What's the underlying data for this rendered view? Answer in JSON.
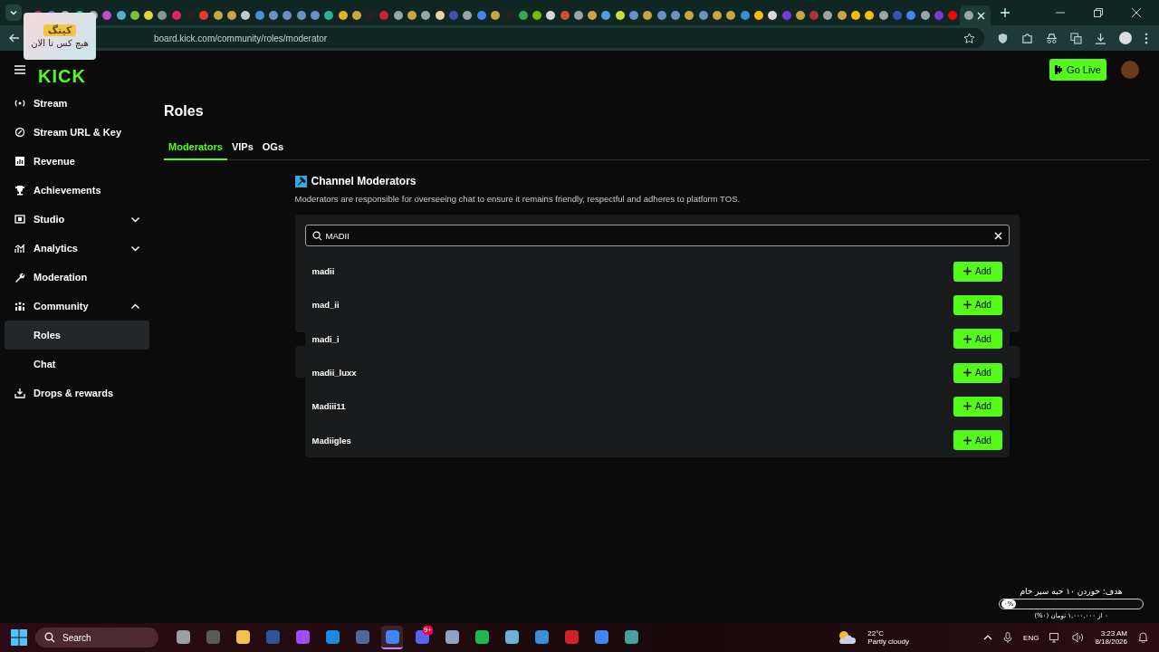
{
  "browser": {
    "tabs": [
      {
        "color": "#e0245e",
        "selected": false
      },
      {
        "color": "#5b6cff",
        "selected": false
      },
      {
        "color": "#8fbf9f",
        "selected": false
      },
      {
        "color": "#2ecc71",
        "selected": false
      },
      {
        "color": "#9aa5a8",
        "selected": false
      },
      {
        "color": "#c04bd0",
        "selected": false
      },
      {
        "color": "#4fb0c6",
        "selected": false
      },
      {
        "color": "#7fbf3f",
        "selected": false
      },
      {
        "color": "#e6d23a",
        "selected": false
      },
      {
        "color": "#8a9490",
        "selected": false
      },
      {
        "color": "#e0245e",
        "selected": false
      },
      {
        "color": "#222222",
        "selected": false
      },
      {
        "color": "#e53935",
        "selected": false
      },
      {
        "color": "#c9a640",
        "selected": false
      },
      {
        "color": "#c9a640",
        "selected": false
      },
      {
        "color": "#bfc7c9",
        "selected": false
      },
      {
        "color": "#4a90d9",
        "selected": false
      },
      {
        "color": "#6d8fc7",
        "selected": false
      },
      {
        "color": "#6d8fc7",
        "selected": false
      },
      {
        "color": "#6d8fc7",
        "selected": false
      },
      {
        "color": "#6d8fc7",
        "selected": false
      },
      {
        "color": "#2bb39a",
        "selected": false
      },
      {
        "color": "#e6b422",
        "selected": false
      },
      {
        "color": "#c9a640",
        "selected": false
      },
      {
        "color": "#222222",
        "selected": false
      },
      {
        "color": "#c8203a",
        "selected": false
      },
      {
        "color": "#9aa5a8",
        "selected": false
      },
      {
        "color": "#c9a640",
        "selected": false
      },
      {
        "color": "#9aa5a8",
        "selected": false
      },
      {
        "color": "#e8d7a0",
        "selected": false
      },
      {
        "color": "#3f51b5",
        "selected": false
      },
      {
        "color": "#9aa5a8",
        "selected": false
      },
      {
        "color": "#4285f4",
        "selected": false
      },
      {
        "color": "#c9a640",
        "selected": false
      },
      {
        "color": "#222222",
        "selected": false
      },
      {
        "color": "#34a853",
        "selected": false
      },
      {
        "color": "#76b900",
        "selected": false
      },
      {
        "color": "#d8d8d8",
        "selected": false
      },
      {
        "color": "#d04a3a",
        "selected": false
      },
      {
        "color": "#9aa5a8",
        "selected": false
      },
      {
        "color": "#c9a640",
        "selected": false
      },
      {
        "color": "#4aa0e0",
        "selected": false
      },
      {
        "color": "#c6e03a",
        "selected": false
      },
      {
        "color": "#6d8fc7",
        "selected": false
      },
      {
        "color": "#c9a640",
        "selected": false
      },
      {
        "color": "#6d8fc7",
        "selected": false
      },
      {
        "color": "#6d8fc7",
        "selected": false
      },
      {
        "color": "#c9a640",
        "selected": false
      },
      {
        "color": "#6d8fc7",
        "selected": false
      },
      {
        "color": "#c9a640",
        "selected": false
      },
      {
        "color": "#c9a640",
        "selected": false
      },
      {
        "color": "#3a8fd8",
        "selected": false
      },
      {
        "color": "#fbbc04",
        "selected": false
      },
      {
        "color": "#d8d8d8",
        "selected": false
      },
      {
        "color": "#7a3ad8",
        "selected": false
      },
      {
        "color": "#c9a640",
        "selected": false
      },
      {
        "color": "#b03040",
        "selected": false
      },
      {
        "color": "#9aa5a8",
        "selected": false
      },
      {
        "color": "#c9a640",
        "selected": false
      },
      {
        "color": "#fbbc04",
        "selected": false
      },
      {
        "color": "#fbbc04",
        "selected": false
      },
      {
        "color": "#9aa5a8",
        "selected": false
      },
      {
        "color": "#3f51b5",
        "selected": false
      },
      {
        "color": "#4285f4",
        "selected": false
      },
      {
        "color": "#9aa5a8",
        "selected": false
      },
      {
        "color": "#7a3ad8",
        "selected": false
      },
      {
        "color": "#ff0000",
        "selected": false
      },
      {
        "color": "#9aa5a8",
        "selected": true
      }
    ],
    "url": "board.kick.com/community/roles/moderator"
  },
  "overlay": {
    "badge": "کینگ",
    "caption": "هیچ کس تا الان"
  },
  "header": {
    "logo": "KICK",
    "go_live": "Go Live"
  },
  "sidebar": {
    "items": [
      {
        "label": "Stream",
        "selected": false
      },
      {
        "label": "Stream URL & Key",
        "selected": false
      },
      {
        "label": "Revenue",
        "selected": false
      },
      {
        "label": "Achievements",
        "selected": false
      },
      {
        "label": "Studio",
        "selected": false,
        "expanded": false
      },
      {
        "label": "Analytics",
        "selected": false,
        "expanded": false
      },
      {
        "label": "Moderation",
        "selected": false
      },
      {
        "label": "Community",
        "selected": false,
        "expanded": true,
        "children": [
          {
            "label": "Roles",
            "selected": true
          },
          {
            "label": "Chat",
            "selected": false
          }
        ]
      },
      {
        "label": "Drops & rewards",
        "selected": false
      }
    ]
  },
  "page": {
    "title": "Roles",
    "tabs": [
      {
        "label": "Moderators",
        "selected": true
      },
      {
        "label": "VIPs",
        "selected": false
      },
      {
        "label": "OGs",
        "selected": false
      }
    ],
    "section": {
      "title": "Channel Moderators",
      "description": "Moderators are responsible for overseeing chat to ensure it remains friendly, respectful and adheres to platform TOS."
    },
    "search": {
      "value": "MADII"
    },
    "results": [
      {
        "name": "madii",
        "action": "Add"
      },
      {
        "name": "mad_ii",
        "action": "Add"
      },
      {
        "name": "madi_i",
        "action": "Add"
      },
      {
        "name": "madii_luxx",
        "action": "Add"
      },
      {
        "name": "Madiii11",
        "action": "Add"
      },
      {
        "name": "Madiigles",
        "action": "Add"
      }
    ]
  },
  "goal": {
    "title": "هدف: خوردن ۱۰ حبه سیر خام",
    "percent": "۰%",
    "level": 0,
    "detail": "۰ از ۱,۰۰۰,۰۰۰ تومان (۰%)"
  },
  "taskbar": {
    "search": "Search",
    "apps": [
      {
        "color": "#9aa0a6",
        "selected": false
      },
      {
        "color": "#5a5a5a",
        "selected": false
      },
      {
        "color": "#f2c14e",
        "selected": false
      },
      {
        "color": "#2b579a",
        "selected": false
      },
      {
        "color": "#9b4dff",
        "selected": false
      },
      {
        "color": "#1e88e5",
        "selected": false
      },
      {
        "color": "#4a6a9a",
        "selected": false
      },
      {
        "color": "#4285f4",
        "selected": true
      },
      {
        "color": "#5865f2",
        "selected": false,
        "badge": "9+"
      },
      {
        "color": "#8fa3c0",
        "selected": false
      },
      {
        "color": "#1db954",
        "selected": false
      },
      {
        "color": "#6ab0d8",
        "selected": false
      },
      {
        "color": "#3a8fd8",
        "selected": false
      },
      {
        "color": "#d0202a",
        "selected": false
      },
      {
        "color": "#4285f4",
        "selected": false
      },
      {
        "color": "#4aa0a0",
        "selected": false
      }
    ],
    "temperature": "22°C",
    "weather": "Partly cloudy",
    "language": "ENG",
    "time": "3:23 AM",
    "date": "8/18/2026"
  }
}
